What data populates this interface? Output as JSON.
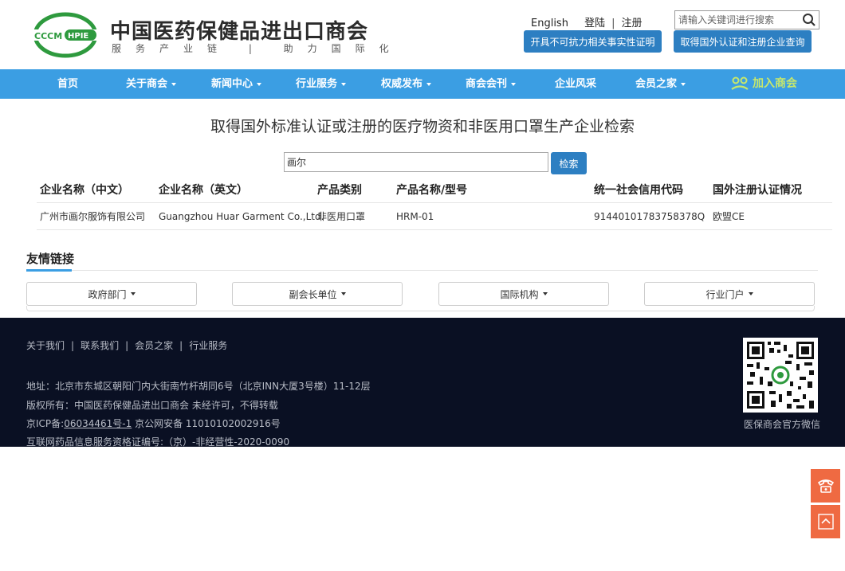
{
  "header": {
    "logo_text": "CCCM HPIE",
    "title": "中国医药保健品进出口商会",
    "slogan": "服务产业链 | 助力国际化",
    "toplinks": {
      "english": "English",
      "login": "登陆",
      "register": "注册"
    },
    "search": {
      "placeholder": "请输入关键词进行搜索"
    },
    "buttons": {
      "force_majeure": "开具不可抗力相关事实性证明",
      "cert_query": "取得国外认证和注册企业查询"
    }
  },
  "nav": {
    "items": [
      {
        "label": "首页",
        "dropdown": false
      },
      {
        "label": "关于商会",
        "dropdown": true
      },
      {
        "label": "新闻中心",
        "dropdown": true
      },
      {
        "label": "行业服务",
        "dropdown": true
      },
      {
        "label": "权威发布",
        "dropdown": true
      },
      {
        "label": "商会会刊",
        "dropdown": true
      },
      {
        "label": "企业风采",
        "dropdown": false
      },
      {
        "label": "会员之家",
        "dropdown": true
      }
    ],
    "join": "加入商会"
  },
  "main": {
    "title": "取得国外标准认证或注册的医疗物资和非医用口罩生产企业检索",
    "query_value": "画尔",
    "query_button": "检索",
    "columns": [
      "企业名称（中文）",
      "企业名称（英文）",
      "产品类别",
      "产品名称/型号",
      "统一社会信用代码",
      "国外注册认证情况"
    ],
    "rows": [
      [
        "广州市画尔服饰有限公司",
        "Guangzhou Huar Garment Co.,Ltd.",
        "非医用口罩",
        "HRM-01",
        "91440101783758378Q",
        "欧盟CE"
      ]
    ]
  },
  "friend_links": {
    "title": "友情链接",
    "dropdowns": [
      "政府部门",
      "副会长单位",
      "国际机构",
      "行业门户"
    ]
  },
  "footer": {
    "links": [
      "关于我们",
      "联系我们",
      "会员之家",
      "行业服务"
    ],
    "address": "地址：北京市东城区朝阳门内大街南竹杆胡同6号（北京INN大厦3号楼）11-12层",
    "copyright": "版权所有：中国医药保健品进出口商会 未经许可，不得转载",
    "icp_prefix": "京ICP备:",
    "icp_number": "06034461号-1",
    "icp_suffix": " 京公网安备 11010102002916号",
    "drug_license": "互联网药品信息服务资格证编号:（京）-非经营性-2020-0090",
    "qr_caption": "医保商会官方微信"
  },
  "colors": {
    "nav_bg": "#3b9ee3",
    "button_blue": "#2d7fc2",
    "footer_bg": "#0a1023",
    "side_orange": "#ef6a42",
    "logo_green": "#2e9a3e",
    "join_green": "#c8e86a"
  },
  "icons": {
    "search": "magnifier-icon",
    "join": "people-icon",
    "side_phone": "phone-icon",
    "side_top": "arrow-up-icon"
  }
}
